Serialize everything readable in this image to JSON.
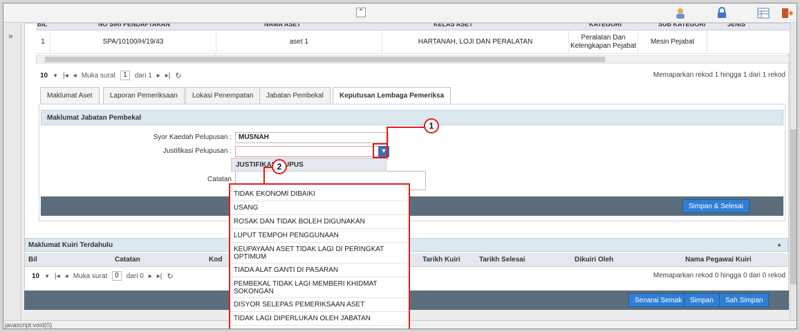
{
  "nav": {
    "expand_glyph": "»"
  },
  "topbar": {
    "collapse_glyph": "⌃"
  },
  "asset_table": {
    "headers": [
      "BIL",
      "NO SIRI PENDAFTARAN",
      "NAMA ASET",
      "KELAS ASET",
      "KATEGORI",
      "SUB KATEGORI",
      "JENIS"
    ],
    "rows": [
      {
        "bil": "1",
        "no_siri": "SPA/10100/H/19/43",
        "nama": "aset 1",
        "kelas": "HARTANAH, LOJI DAN PERALATAN",
        "kategori": "Peralatan Dan Kelengkapan Pejabat",
        "sub_kategori": "Mesin Pejabat",
        "jenis": ""
      }
    ],
    "pager": {
      "page_size": "10",
      "page_label": "Muka surat",
      "page_value": "1",
      "of_label": "dari 1",
      "status": "Memaparkan rekod 1 hingga 1 dari 1 rekod"
    }
  },
  "tabs": [
    "Maklumat Aset",
    "Laporan Pemeriksaan",
    "Lokasi Penempatan",
    "Jabatan Pembekal",
    "Keputusan Lembaga Pemeriksa"
  ],
  "form": {
    "section_title": "Maklumat Jabatan Pembekal",
    "syor_label": "Syor Kaedah Pelupusan :",
    "syor_value": "MUSNAH",
    "justifikasi_label": "Justifikasi Pelupusan :",
    "justifikasi_value": "",
    "catatan_label": "Catatan",
    "save_button": "Simpan & Selesai"
  },
  "dropdown": {
    "header": "JUSTIFIKASI LUPUS",
    "items": [
      "TIDAK EKONOMI DIBAIKI",
      "USANG",
      "ROSAK DAN TIDAK BOLEH DIGUNAKAN",
      "LUPUT TEMPOH PENGGUNAAN",
      "KEUPAYAAN ASET TIDAK LAGI DI PERINGKAT OPTIMUM",
      "TIADA ALAT GANTI DI PASARAN",
      "PEMBEKAL TIDAK LAGI MEMBERI KHIDMAT SOKONGAN",
      "DISYOR SELEPAS PEMERIKSAAN ASET",
      "TIDAK LAGI DIPERLUKAN OLEH JABATAN"
    ]
  },
  "kuiri": {
    "section_title": "Maklumat Kuiri Terdahulu",
    "headers": [
      "Bil",
      "Catatan",
      "Kod",
      "Tarikh Kuiri",
      "Tarikh Selesai",
      "Dikuiri Oleh",
      "Nama Pegawai Kuiri"
    ],
    "pager": {
      "page_size": "10",
      "page_label": "Muka surat",
      "page_value": "0",
      "of_label": "dari 0",
      "status": "Memaparkan rekod 0 hingga 0 dari 0 rekod"
    }
  },
  "footer_buttons": {
    "senarai_semak": "Senarai Semak",
    "simpan": "Simpan",
    "sah_simpan": "Sah Simpan"
  },
  "callouts": {
    "one": "1",
    "two": "2"
  },
  "statusbar": {
    "text": "javascript:void(0)"
  },
  "colors": {
    "accent_blue": "#2f7fd4",
    "dark_bar": "#5b6d7a",
    "annotation_red": "#e31b1b"
  }
}
